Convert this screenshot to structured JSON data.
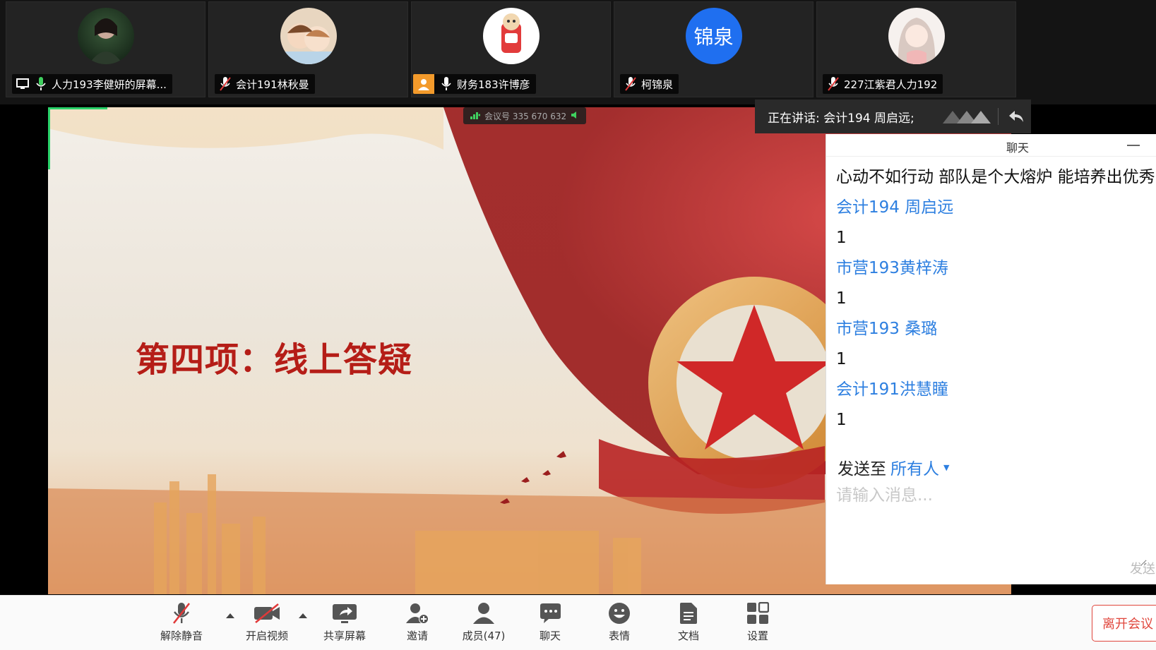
{
  "participants": [
    {
      "name": "人力193李健妍的屏幕...",
      "avatar_icon": "photo-avatar-dark",
      "mic_icon": "mic-on-icon",
      "extra_icon": "screen-share-icon"
    },
    {
      "name": "会计191林秋曼",
      "avatar_icon": "cartoon-couple-avatar",
      "mic_icon": "mic-muted-icon"
    },
    {
      "name": "财务183许博彦",
      "avatar_icon": "cartoon-drink-avatar",
      "mic_icon": "mic-on-icon",
      "extra_icon": "user-icon"
    },
    {
      "name": "柯锦泉",
      "avatar_text": "锦泉",
      "avatar_color": "#1f6ff0",
      "mic_icon": "mic-muted-icon"
    },
    {
      "name": "227江紫君人力192",
      "avatar_icon": "anime-girl-avatar",
      "mic_icon": "mic-muted-icon"
    }
  ],
  "meeting": {
    "id_label": "会议号 335 670 632"
  },
  "slide": {
    "title": "第四项：线上答疑"
  },
  "speaking": {
    "label": "正在讲话: 会计194 周启远;"
  },
  "chat": {
    "title": "聊天",
    "messages": [
      {
        "type": "text",
        "value": "心动不如行动 部队是个大熔炉 能培养出优秀的"
      },
      {
        "type": "sender",
        "value": "会计194 周启远"
      },
      {
        "type": "text",
        "value": "1"
      },
      {
        "type": "sender",
        "value": "市营193黄梓涛"
      },
      {
        "type": "text",
        "value": "1"
      },
      {
        "type": "sender",
        "value": "市营193 桑璐"
      },
      {
        "type": "text",
        "value": "1"
      },
      {
        "type": "sender",
        "value": "会计191洪慧瞳"
      },
      {
        "type": "text",
        "value": "1"
      }
    ],
    "send_to_label": "发送至",
    "send_to_target": "所有人",
    "input_placeholder": "请输入消息...",
    "send_label": "发送"
  },
  "toolbar": {
    "unmute": "解除静音",
    "start_video": "开启视频",
    "share_screen": "共享屏幕",
    "invite": "邀请",
    "members": "成员(47)",
    "chat": "聊天",
    "reactions": "表情",
    "docs": "文档",
    "settings": "设置",
    "leave": "离开会议"
  },
  "colors": {
    "accent": "#2d7fe0",
    "leave": "#e0463c",
    "slide_title": "#b51d17"
  }
}
